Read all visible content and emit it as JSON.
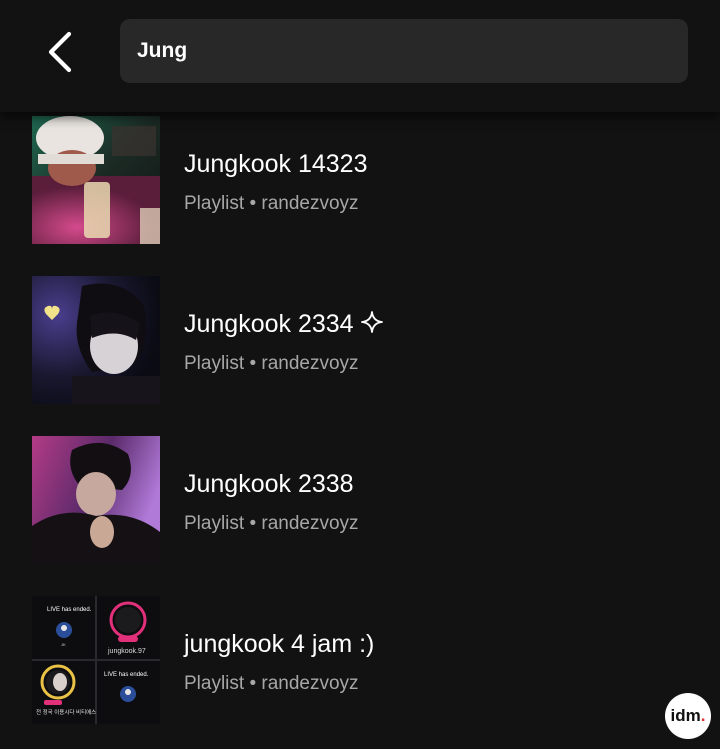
{
  "search": {
    "query": "Jung"
  },
  "results": [
    {
      "title": "Jungkook 14323",
      "subtitle": "Playlist • randezvoyz"
    },
    {
      "title": "Jungkook 2334",
      "subtitle": "Playlist • randezvoyz",
      "badge_icon": "sparkle-icon"
    },
    {
      "title": "Jungkook 2338",
      "subtitle": "Playlist • randezvoyz"
    },
    {
      "title": "jungkook 4 jam :)",
      "subtitle": "Playlist • randezvoyz"
    }
  ],
  "cover4_text": {
    "live_ended_1": "LIVE has ended.",
    "live_ended_2": "LIVE has ended.",
    "username": "jungkook.97",
    "korean": "전 정국 이용시다 비티에스",
    "jk": "JK"
  },
  "logo": {
    "text": "idm",
    "dot": "."
  },
  "colors": {
    "background": "#121212",
    "search_field": "#282828",
    "text_primary": "#ffffff",
    "text_secondary": "#a7a7a7"
  }
}
